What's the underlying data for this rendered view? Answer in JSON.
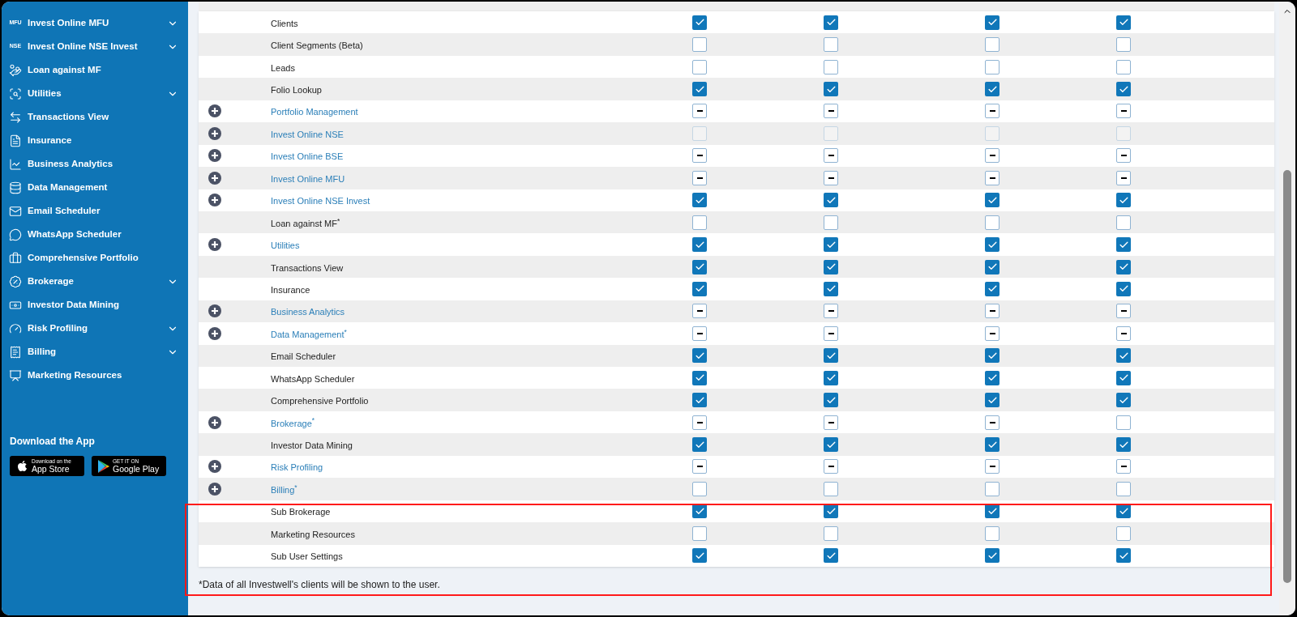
{
  "sidebar": {
    "items": [
      {
        "kind": "badge",
        "badge": "MFU",
        "label": "Invest Online MFU",
        "expandable": true
      },
      {
        "kind": "badge",
        "badge": "NSE",
        "label": "Invest Online NSE Invest",
        "expandable": true
      },
      {
        "kind": "icon",
        "label": "Loan against MF",
        "expandable": false
      },
      {
        "kind": "icon",
        "label": "Utilities",
        "expandable": true
      },
      {
        "kind": "icon",
        "label": "Transactions View",
        "expandable": false
      },
      {
        "kind": "icon",
        "label": "Insurance",
        "expandable": false
      },
      {
        "kind": "icon",
        "label": "Business Analytics",
        "expandable": false
      },
      {
        "kind": "icon",
        "label": "Data Management",
        "expandable": false
      },
      {
        "kind": "icon",
        "label": "Email Scheduler",
        "expandable": false
      },
      {
        "kind": "icon",
        "label": "WhatsApp Scheduler",
        "expandable": false
      },
      {
        "kind": "icon",
        "label": "Comprehensive Portfolio",
        "expandable": false
      },
      {
        "kind": "icon",
        "label": "Brokerage",
        "expandable": true
      },
      {
        "kind": "icon",
        "label": "Investor Data Mining",
        "expandable": false
      },
      {
        "kind": "icon",
        "label": "Risk Profiling",
        "expandable": true
      },
      {
        "kind": "icon",
        "label": "Billing",
        "expandable": true
      },
      {
        "kind": "icon",
        "label": "Marketing Resources",
        "expandable": false
      }
    ],
    "download": {
      "title": "Download the App",
      "stores": [
        {
          "kind": "apple",
          "small": "Download on the",
          "big": "App Store"
        },
        {
          "kind": "google",
          "small": "GET IT ON",
          "big": "Google Play"
        }
      ]
    }
  },
  "table": {
    "rows": [
      {
        "kind": "item",
        "label": "Clients",
        "cells": [
          {
            "kind": "box",
            "checked": true
          },
          {
            "kind": "box",
            "checked": true
          },
          {
            "kind": "box",
            "checked": true
          },
          {
            "kind": "box",
            "checked": true
          }
        ]
      },
      {
        "kind": "item",
        "label": "Client Segments (Beta)",
        "cells": [
          {
            "kind": "box",
            "checked": false
          },
          {
            "kind": "box",
            "checked": false
          },
          {
            "kind": "box",
            "checked": false
          },
          {
            "kind": "box",
            "checked": false
          }
        ]
      },
      {
        "kind": "item",
        "label": "Leads",
        "cells": [
          {
            "kind": "box",
            "checked": false
          },
          {
            "kind": "box",
            "checked": false
          },
          {
            "kind": "box",
            "checked": false
          },
          {
            "kind": "box",
            "checked": false
          }
        ]
      },
      {
        "kind": "item",
        "label": "Folio Lookup",
        "cells": [
          {
            "kind": "box",
            "checked": true
          },
          {
            "kind": "box",
            "checked": true
          },
          {
            "kind": "box",
            "checked": true
          },
          {
            "kind": "box",
            "checked": true
          }
        ]
      },
      {
        "kind": "group",
        "label": "Portfolio Management",
        "cells": [
          {
            "kind": "mixed"
          },
          {
            "kind": "mixed"
          },
          {
            "kind": "mixed"
          },
          {
            "kind": "mixed"
          }
        ]
      },
      {
        "kind": "group",
        "label": "Invest Online NSE",
        "cells": [
          {
            "kind": "disabled"
          },
          {
            "kind": "disabled"
          },
          {
            "kind": "disabled"
          },
          {
            "kind": "disabled"
          }
        ]
      },
      {
        "kind": "group",
        "label": "Invest Online BSE",
        "cells": [
          {
            "kind": "mixed"
          },
          {
            "kind": "mixed"
          },
          {
            "kind": "mixed"
          },
          {
            "kind": "mixed"
          }
        ]
      },
      {
        "kind": "group",
        "label": "Invest Online MFU",
        "cells": [
          {
            "kind": "mixed"
          },
          {
            "kind": "mixed"
          },
          {
            "kind": "mixed"
          },
          {
            "kind": "mixed"
          }
        ]
      },
      {
        "kind": "group",
        "label": "Invest Online NSE Invest",
        "cells": [
          {
            "kind": "box",
            "checked": true
          },
          {
            "kind": "box",
            "checked": true
          },
          {
            "kind": "box",
            "checked": true
          },
          {
            "kind": "box",
            "checked": true
          }
        ]
      },
      {
        "kind": "item",
        "label": "Loan against MF$^{*}$",
        "cells": [
          {
            "kind": "box",
            "checked": false
          },
          {
            "kind": "box",
            "checked": false
          },
          {
            "kind": "box",
            "checked": false
          },
          {
            "kind": "box",
            "checked": false
          }
        ]
      },
      {
        "kind": "group",
        "label": "Utilities",
        "cells": [
          {
            "kind": "box",
            "checked": true
          },
          {
            "kind": "box",
            "checked": true
          },
          {
            "kind": "box",
            "checked": true
          },
          {
            "kind": "box",
            "checked": true
          }
        ]
      },
      {
        "kind": "item",
        "label": "Transactions View",
        "cells": [
          {
            "kind": "box",
            "checked": true
          },
          {
            "kind": "box",
            "checked": true
          },
          {
            "kind": "box",
            "checked": true
          },
          {
            "kind": "box",
            "checked": true
          }
        ]
      },
      {
        "kind": "item",
        "label": "Insurance",
        "cells": [
          {
            "kind": "box",
            "checked": true
          },
          {
            "kind": "box",
            "checked": true
          },
          {
            "kind": "box",
            "checked": true
          },
          {
            "kind": "box",
            "checked": true
          }
        ]
      },
      {
        "kind": "group",
        "label": "Business Analytics",
        "cells": [
          {
            "kind": "mixed"
          },
          {
            "kind": "mixed"
          },
          {
            "kind": "mixed"
          },
          {
            "kind": "mixed"
          }
        ]
      },
      {
        "kind": "group",
        "label": "Data Management$^{*}$",
        "cells": [
          {
            "kind": "mixed"
          },
          {
            "kind": "mixed"
          },
          {
            "kind": "mixed"
          },
          {
            "kind": "mixed"
          }
        ]
      },
      {
        "kind": "item",
        "label": "Email Scheduler",
        "cells": [
          {
            "kind": "box",
            "checked": true
          },
          {
            "kind": "box",
            "checked": true
          },
          {
            "kind": "box",
            "checked": true
          },
          {
            "kind": "box",
            "checked": true
          }
        ]
      },
      {
        "kind": "item",
        "label": "WhatsApp Scheduler",
        "cells": [
          {
            "kind": "box",
            "checked": true
          },
          {
            "kind": "box",
            "checked": true
          },
          {
            "kind": "box",
            "checked": true
          },
          {
            "kind": "box",
            "checked": true
          }
        ]
      },
      {
        "kind": "item",
        "label": "Comprehensive Portfolio",
        "cells": [
          {
            "kind": "box",
            "checked": true
          },
          {
            "kind": "box",
            "checked": true
          },
          {
            "kind": "box",
            "checked": true
          },
          {
            "kind": "box",
            "checked": true
          }
        ]
      },
      {
        "kind": "group",
        "label": "Brokerage$^{*}$",
        "cells": [
          {
            "kind": "mixed"
          },
          {
            "kind": "mixed"
          },
          {
            "kind": "mixed"
          },
          {
            "kind": "box",
            "checked": false
          }
        ]
      },
      {
        "kind": "item",
        "label": "Investor Data Mining",
        "cells": [
          {
            "kind": "box",
            "checked": true
          },
          {
            "kind": "box",
            "checked": true
          },
          {
            "kind": "box",
            "checked": true
          },
          {
            "kind": "box",
            "checked": true
          }
        ]
      },
      {
        "kind": "group",
        "label": "Risk Profiling",
        "cells": [
          {
            "kind": "mixed"
          },
          {
            "kind": "mixed"
          },
          {
            "kind": "mixed"
          },
          {
            "kind": "mixed"
          }
        ]
      },
      {
        "kind": "group",
        "label": "Billing$^{*}$",
        "cells": [
          {
            "kind": "box",
            "checked": false
          },
          {
            "kind": "box",
            "checked": false
          },
          {
            "kind": "box",
            "checked": false
          },
          {
            "kind": "box",
            "checked": false
          }
        ]
      },
      {
        "kind": "item",
        "label": "Sub Brokerage",
        "cells": [
          {
            "kind": "box",
            "checked": true
          },
          {
            "kind": "box",
            "checked": true
          },
          {
            "kind": "box",
            "checked": true
          },
          {
            "kind": "box",
            "checked": true
          }
        ]
      },
      {
        "kind": "item",
        "label": "Marketing Resources",
        "cells": [
          {
            "kind": "box",
            "checked": false
          },
          {
            "kind": "box",
            "checked": false
          },
          {
            "kind": "box",
            "checked": false
          },
          {
            "kind": "box",
            "checked": false
          }
        ]
      },
      {
        "kind": "item",
        "label": "Sub User Settings",
        "cells": [
          {
            "kind": "box",
            "checked": true
          },
          {
            "kind": "box",
            "checked": true
          },
          {
            "kind": "box",
            "checked": true
          },
          {
            "kind": "box",
            "checked": true
          }
        ]
      }
    ],
    "footnote": "*Data of all Investwell's clients will be shown to the user."
  }
}
